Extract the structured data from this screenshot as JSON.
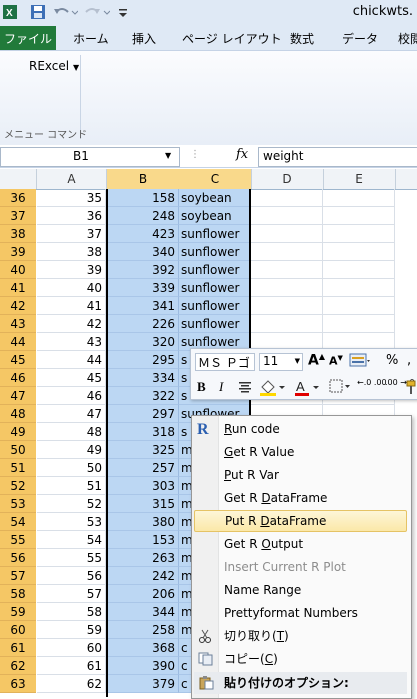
{
  "window": {
    "title": "chickwts."
  },
  "ribbon": {
    "tabs": [
      "ファイル",
      "ホーム",
      "挿入",
      "ページ レイアウト",
      "数式",
      "データ",
      "校閲"
    ],
    "addin_button": "RExcel",
    "group_caption": "メニュー コマンド"
  },
  "formula_bar": {
    "name_box": "B1",
    "fx": "fx",
    "value": "weight"
  },
  "grid": {
    "columns": [
      "A",
      "B",
      "C",
      "D",
      "E"
    ],
    "rows": [
      {
        "n": "36",
        "a": "35",
        "b": "158",
        "c": "soybean"
      },
      {
        "n": "37",
        "a": "36",
        "b": "248",
        "c": "soybean"
      },
      {
        "n": "38",
        "a": "37",
        "b": "423",
        "c": "sunflower"
      },
      {
        "n": "39",
        "a": "38",
        "b": "340",
        "c": "sunflower"
      },
      {
        "n": "40",
        "a": "39",
        "b": "392",
        "c": "sunflower"
      },
      {
        "n": "41",
        "a": "40",
        "b": "339",
        "c": "sunflower"
      },
      {
        "n": "42",
        "a": "41",
        "b": "341",
        "c": "sunflower"
      },
      {
        "n": "43",
        "a": "42",
        "b": "226",
        "c": "sunflower"
      },
      {
        "n": "44",
        "a": "43",
        "b": "320",
        "c": "sunflower"
      },
      {
        "n": "45",
        "a": "44",
        "b": "295",
        "c": "s"
      },
      {
        "n": "46",
        "a": "45",
        "b": "334",
        "c": "s"
      },
      {
        "n": "47",
        "a": "46",
        "b": "322",
        "c": "s"
      },
      {
        "n": "48",
        "a": "47",
        "b": "297",
        "c": "sunflower"
      },
      {
        "n": "49",
        "a": "48",
        "b": "318",
        "c": "s"
      },
      {
        "n": "50",
        "a": "49",
        "b": "325",
        "c": "m"
      },
      {
        "n": "51",
        "a": "50",
        "b": "257",
        "c": "m"
      },
      {
        "n": "52",
        "a": "51",
        "b": "303",
        "c": "m"
      },
      {
        "n": "53",
        "a": "52",
        "b": "315",
        "c": "m"
      },
      {
        "n": "54",
        "a": "53",
        "b": "380",
        "c": "m"
      },
      {
        "n": "55",
        "a": "54",
        "b": "153",
        "c": "m"
      },
      {
        "n": "56",
        "a": "55",
        "b": "263",
        "c": "m"
      },
      {
        "n": "57",
        "a": "56",
        "b": "242",
        "c": "m"
      },
      {
        "n": "58",
        "a": "57",
        "b": "206",
        "c": "m"
      },
      {
        "n": "59",
        "a": "58",
        "b": "344",
        "c": "m"
      },
      {
        "n": "60",
        "a": "59",
        "b": "258",
        "c": "m"
      },
      {
        "n": "61",
        "a": "60",
        "b": "368",
        "c": "c"
      },
      {
        "n": "62",
        "a": "61",
        "b": "390",
        "c": "c"
      },
      {
        "n": "63",
        "a": "62",
        "b": "379",
        "c": "c"
      }
    ]
  },
  "mini_toolbar": {
    "font_name": "ＭＳ Ｐゴ",
    "font_size": "11",
    "grow": "A",
    "shrink": "A",
    "percent": "%",
    "bold": "B",
    "italic": "I",
    "font_color_letter": "A",
    "decimal_more": "←.0 .00",
    "decimal_less": ".00 →.0"
  },
  "context_menu": {
    "items": [
      {
        "label": "Run code",
        "accel": "R",
        "rest": "un code"
      },
      {
        "label": "Get R Value",
        "accel": "G",
        "rest": "et R Value"
      },
      {
        "label": "Put R Var",
        "accel": "P",
        "rest": "ut R Var"
      },
      {
        "label": "Get R DataFrame",
        "pre": "Get R ",
        "accel": "D",
        "rest": "ataFrame"
      },
      {
        "label": "Put R DataFrame",
        "pre": "Put R ",
        "accel": "D",
        "rest": "ataFrame"
      },
      {
        "label": "Get R Output",
        "pre": "Get R ",
        "accel": "O",
        "rest": "utput"
      },
      {
        "label": "Insert Current R Plot"
      },
      {
        "label": "Name Range"
      },
      {
        "label": "Prettyformat Numbers"
      },
      {
        "label": "切り取り(T)",
        "pre": "切り取り(",
        "accel": "T",
        "rest": ")"
      },
      {
        "label": "コピー(C)",
        "pre": "コピー(",
        "accel": "C",
        "rest": ")"
      },
      {
        "label": "貼り付けのオプション:"
      }
    ]
  },
  "colors": {
    "row_header_selected": "#f5c765",
    "selection": "#bcd7f3",
    "file_tab": "#217a3a",
    "highlight": "#fbe8a8"
  }
}
